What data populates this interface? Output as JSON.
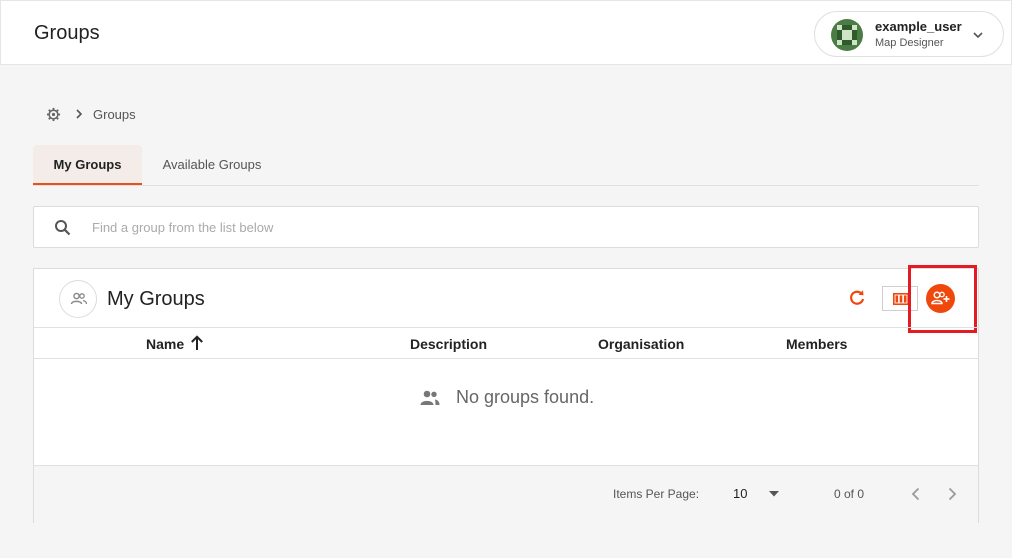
{
  "header": {
    "title": "Groups",
    "user": {
      "name": "example_user",
      "role": "Map Designer",
      "avatar_icon": "identicon-avatar",
      "avatar_color": "#4c7c46"
    }
  },
  "breadcrumb": {
    "home_icon": "gear-icon",
    "current": "Groups"
  },
  "tabs": [
    {
      "label": "My Groups",
      "active": true
    },
    {
      "label": "Available Groups",
      "active": false
    }
  ],
  "search": {
    "placeholder": "Find a group from the list below",
    "value": ""
  },
  "panel": {
    "title": "My Groups",
    "icon": "group-icon",
    "actions": [
      "refresh-icon",
      "columns-icon",
      "add-group-icon"
    ],
    "accent_color": "#f0480c",
    "highlight_color": "#e41b23"
  },
  "table": {
    "columns": [
      {
        "label": "Name",
        "sorted": "ascending"
      },
      {
        "label": "Description"
      },
      {
        "label": "Organisation"
      },
      {
        "label": "Members"
      }
    ],
    "rows": [],
    "empty_message": "No groups found."
  },
  "pagination": {
    "items_per_page_label": "Items Per Page:",
    "items_per_page": "10",
    "range": "0 of 0"
  }
}
